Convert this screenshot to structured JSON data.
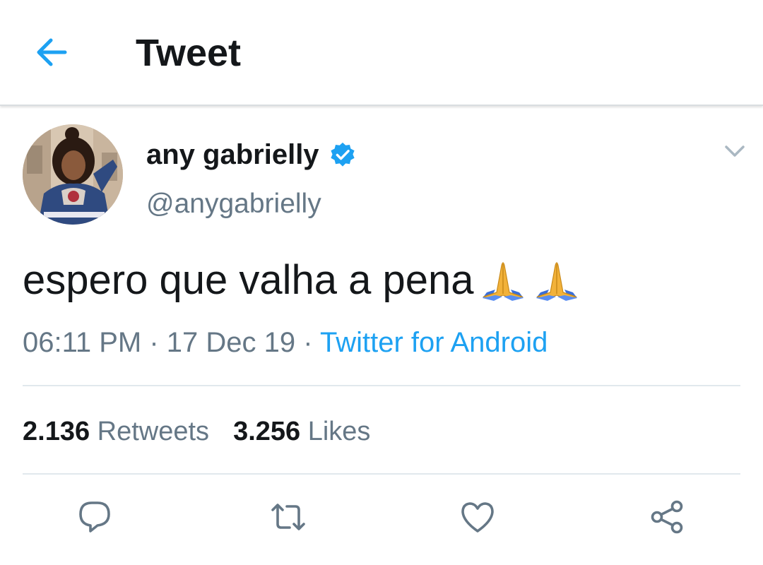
{
  "header": {
    "title": "Tweet",
    "back_icon": "arrow-left-icon",
    "accent_color": "#1da1f2"
  },
  "tweet": {
    "author": {
      "display_name": "any gabrielly",
      "handle": "@anygabrielly",
      "verified": true,
      "verified_icon": "verified-badge-icon"
    },
    "text": "espero que valha a pena",
    "emojis": [
      "folded-hands-emoji",
      "folded-hands-emoji"
    ],
    "time": "06:11 PM",
    "sep1": " · ",
    "date": "17 Dec 19",
    "sep2": " · ",
    "source": "Twitter for Android",
    "menu_icon": "chevron-down-icon"
  },
  "stats": {
    "retweets_count": "2.136",
    "retweets_label": "Retweets",
    "likes_count": "3.256",
    "likes_label": "Likes"
  },
  "actions": [
    {
      "name": "reply",
      "icon": "reply-icon"
    },
    {
      "name": "retweet",
      "icon": "retweet-icon"
    },
    {
      "name": "like",
      "icon": "heart-icon"
    },
    {
      "name": "share",
      "icon": "share-icon"
    }
  ],
  "colors": {
    "text_primary": "#14171a",
    "text_secondary": "#657786",
    "link": "#1da1f2",
    "divider": "#e1e8ed"
  }
}
